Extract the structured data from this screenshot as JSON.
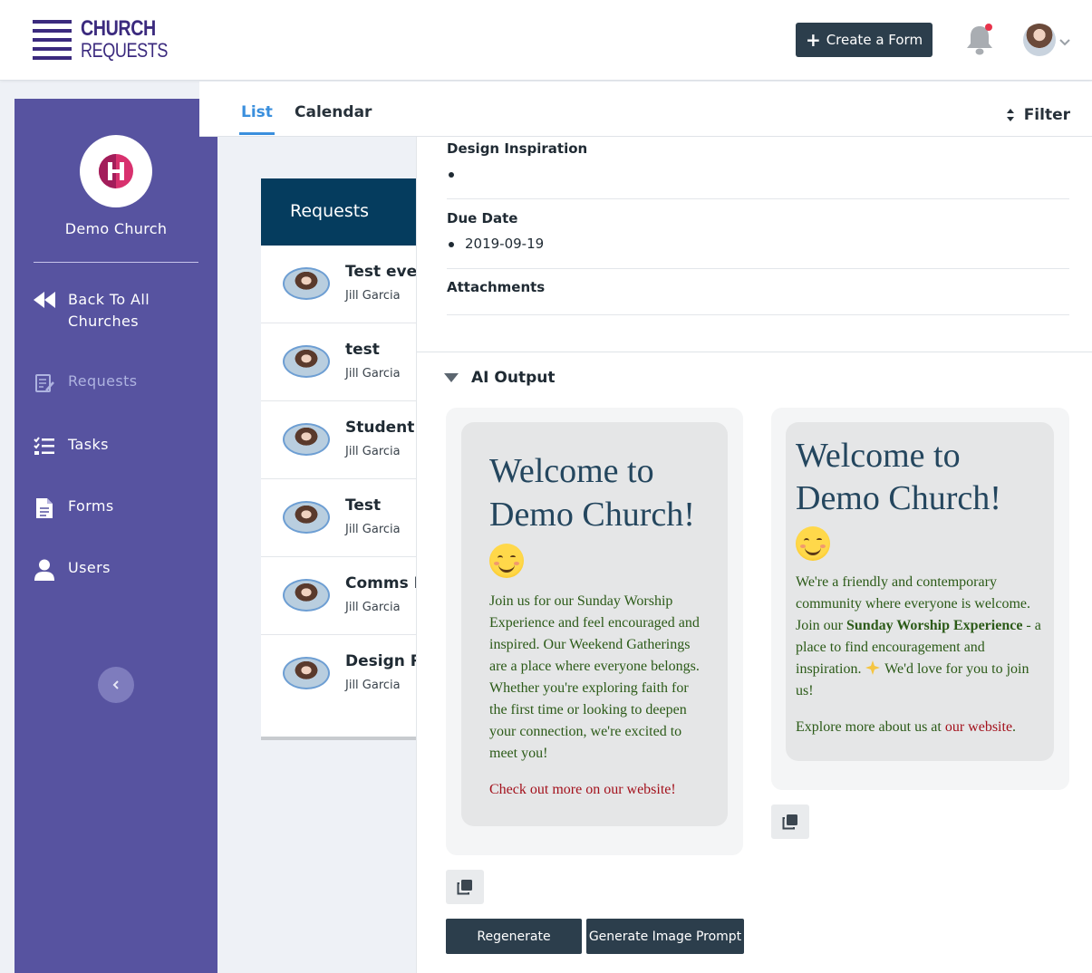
{
  "app": {
    "logo_line1": "CHURCH",
    "logo_line2": "REQUESTS",
    "brand_color": "#3b2a7e"
  },
  "header": {
    "create_form_label": "Create a Form",
    "notification_dot": true
  },
  "sidebar": {
    "church_name": "Demo Church",
    "items": [
      {
        "label": "Back To All Churches",
        "icon": "double-chevron-left-icon",
        "active": false
      },
      {
        "label": "Requests",
        "icon": "requests-icon",
        "active": true
      },
      {
        "label": "Tasks",
        "icon": "checklist-icon",
        "active": false
      },
      {
        "label": "Forms",
        "icon": "document-icon",
        "active": false
      },
      {
        "label": "Users",
        "icon": "user-icon",
        "active": false
      }
    ],
    "bg_color": "#5753a0"
  },
  "tabs": {
    "list": "List",
    "calendar": "Calendar",
    "filter": "Filter"
  },
  "requests": {
    "heading": "Requests",
    "rows": [
      {
        "title": "Test ever",
        "author": "Jill Garcia"
      },
      {
        "title": "test",
        "author": "Jill Garcia"
      },
      {
        "title": "Student T",
        "author": "Jill Garcia"
      },
      {
        "title": "Test",
        "author": "Jill Garcia"
      },
      {
        "title": "Comms R",
        "author": "Jill Garcia"
      },
      {
        "title": "Design R",
        "author": "Jill Garcia"
      }
    ]
  },
  "detail": {
    "fields": [
      {
        "label": "Design Inspiration",
        "value": ""
      },
      {
        "label": "Due Date",
        "value": "2019-09-19"
      },
      {
        "label": "Attachments",
        "value": ""
      }
    ],
    "ai_output_label": "AI Output",
    "outputs": [
      {
        "heading": "Welcome to Demo Church!",
        "body": "Join us for our Sunday Worship Experience and feel encouraged and inspired. Our Weekend Gatherings are a place where everyone belongs. Whether you're exploring faith for the first time or looking to deepen your connection, we're excited to meet you!",
        "link": "Check out more on our website!"
      },
      {
        "heading": "Welcome to Demo Church!",
        "body_a": "We're a friendly and contemporary community where everyone is welcome. Join our ",
        "body_bold": "Sunday Worship Experience",
        "body_b": " - a place to find encouragement and inspiration. ",
        "body_c": " We'd love for you to join us!",
        "explore": "Explore more about us at ",
        "link": "our website",
        "explore_end": "."
      }
    ],
    "regenerate_label": "Regenerate",
    "image_prompt_label": "Generate Image Prompt"
  }
}
